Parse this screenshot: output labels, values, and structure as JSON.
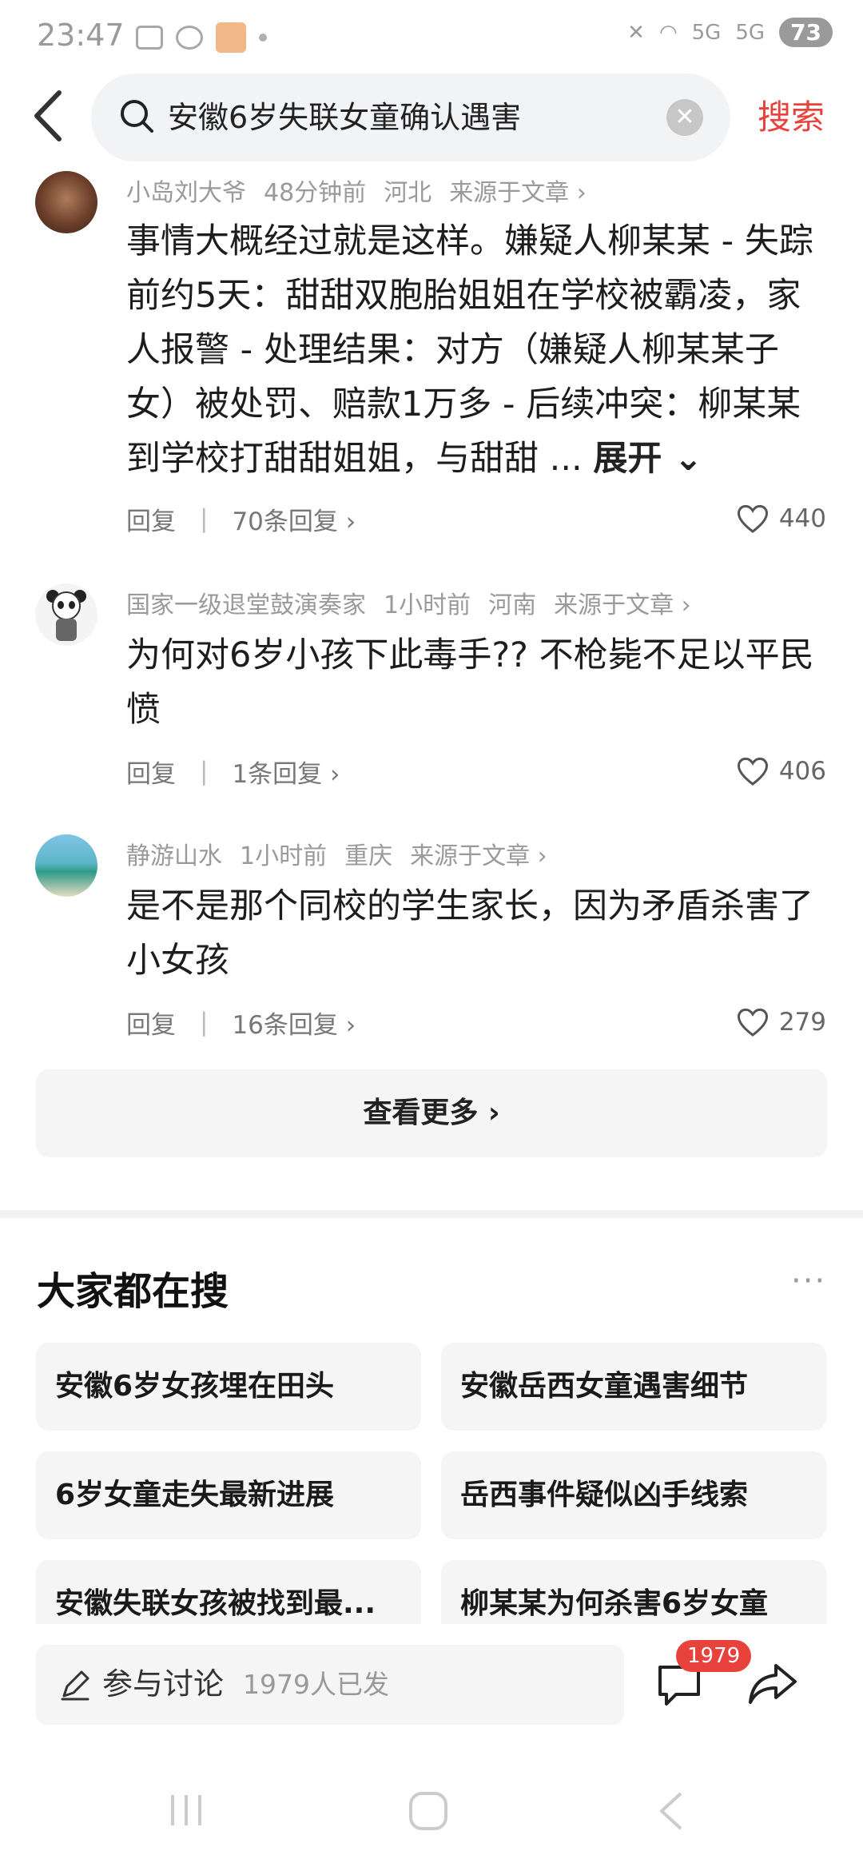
{
  "status": {
    "time": "23:47",
    "battery": "73",
    "sig1": "5G",
    "sig2": "5G"
  },
  "search": {
    "query": "安徽6岁失联女童确认遇害",
    "button": "搜索"
  },
  "comments": [
    {
      "user": "小岛刘大爷",
      "time": "48分钟前",
      "location": "河北",
      "source": "来源于文章 ›",
      "text": "事情大概经过就是这样。嫌疑人柳某某 - 失踪前约5天：甜甜双胞胎姐姐在学校被霸凌，家人报警 - 处理结果：对方（嫌疑人柳某某子女）被处罚、赔款1万多 - 后续冲突：柳某某到学校打甜甜姐姐，与甜甜 ...",
      "expand": "展开 ⌄",
      "reply": "回复",
      "replies": "70条回复 ›",
      "likes": "440"
    },
    {
      "user": "国家一级退堂鼓演奏家",
      "time": "1小时前",
      "location": "河南",
      "source": "来源于文章 ›",
      "text": "为何对6岁小孩下此毒手??  不枪毙不足以平民愤",
      "reply": "回复",
      "replies": "1条回复 ›",
      "likes": "406"
    },
    {
      "user": "静游山水",
      "time": "1小时前",
      "location": "重庆",
      "source": "来源于文章 ›",
      "text": "是不是那个同校的学生家长，因为矛盾杀害了小女孩",
      "reply": "回复",
      "replies": "16条回复 ›",
      "likes": "279"
    }
  ],
  "more_button": "查看更多 ›",
  "trending": {
    "title": "大家都在搜",
    "more": "···",
    "items": [
      "安徽6岁女孩埋在田头",
      "安徽岳西女童遇害细节",
      "6岁女童走失最新进展",
      "岳西事件疑似凶手线索",
      "安徽失联女孩被找到最...",
      "柳某某为何杀害6岁女童"
    ]
  },
  "bottom": {
    "input_label": "参与讨论",
    "input_count": "1979人已发",
    "badge": "1979"
  },
  "colors": {
    "accent": "#e8423c"
  }
}
